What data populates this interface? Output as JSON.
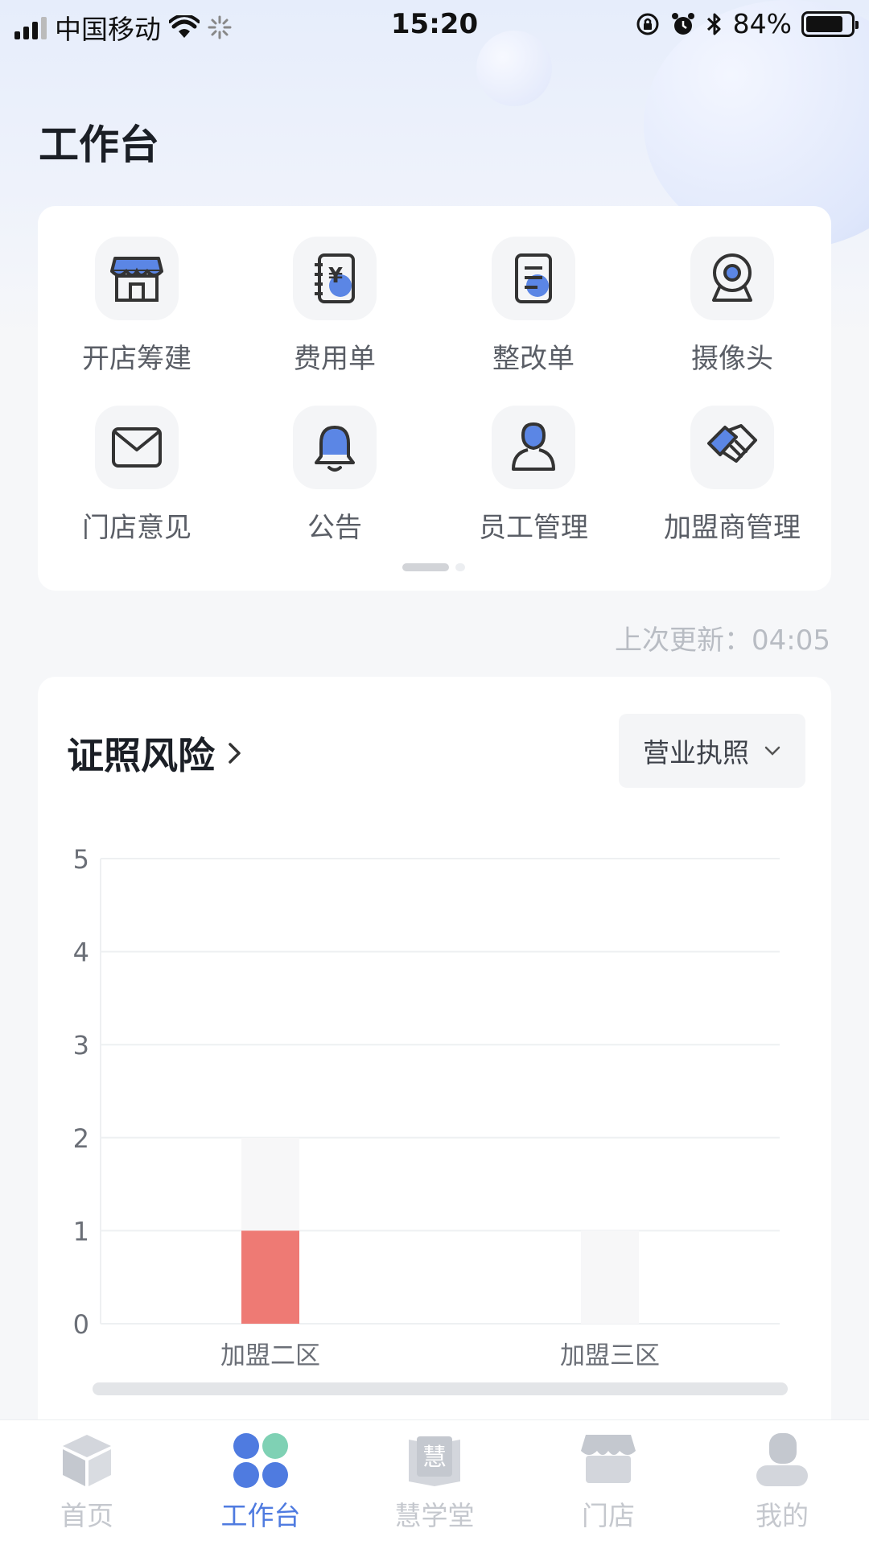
{
  "status_bar": {
    "carrier": "中国移动",
    "time": "15:20",
    "battery": "84%",
    "battery_level": 0.84
  },
  "page": {
    "title": "工作台",
    "last_update": "上次更新：04:05"
  },
  "apps": [
    {
      "label": "开店筹建",
      "icon": "storefront-icon"
    },
    {
      "label": "费用单",
      "icon": "expense-ledger-icon"
    },
    {
      "label": "整改单",
      "icon": "rectification-doc-icon"
    },
    {
      "label": "摄像头",
      "icon": "camera-icon"
    },
    {
      "label": "门店意见",
      "icon": "mail-icon"
    },
    {
      "label": "公告",
      "icon": "bell-icon"
    },
    {
      "label": "员工管理",
      "icon": "person-icon"
    },
    {
      "label": "加盟商管理",
      "icon": "handshake-icon"
    }
  ],
  "license_risk": {
    "title": "证照风险",
    "filter_selected": "营业执照"
  },
  "chart_data": {
    "type": "bar",
    "categories": [
      "加盟二区",
      "加盟三区"
    ],
    "series": [
      {
        "values": [
          2,
          1
        ],
        "color": "#f7f7f8"
      },
      {
        "values": [
          1,
          0
        ],
        "color": "#ee7a74"
      }
    ],
    "ylim": [
      0,
      5
    ],
    "yticks": [
      "0",
      "1",
      "2",
      "3",
      "4",
      "5"
    ],
    "grid": true
  },
  "tabs": [
    {
      "label": "首页",
      "icon": "cube-icon",
      "active": false
    },
    {
      "label": "工作台",
      "icon": "clover-icon",
      "active": true
    },
    {
      "label": "慧学堂",
      "icon": "book-icon",
      "active": false,
      "glyph": "慧"
    },
    {
      "label": "门店",
      "icon": "store-icon",
      "active": false
    },
    {
      "label": "我的",
      "icon": "profile-icon",
      "active": false
    }
  ],
  "colors": {
    "accent": "#4f7be0",
    "risk": "#ee7a74"
  }
}
